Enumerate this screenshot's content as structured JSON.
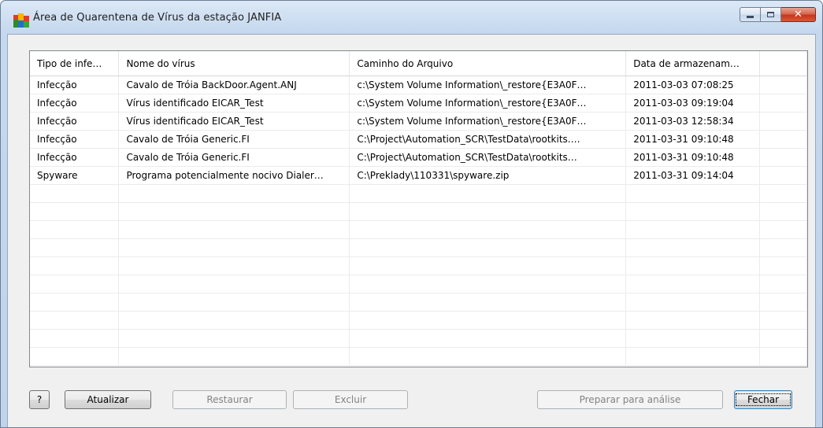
{
  "window": {
    "title": "Área de Quarentena de Vírus da estação JANFIA",
    "app_icon": "avg-logo-icon",
    "controls": {
      "minimize": "minimize-icon",
      "maximize": "maximize-icon",
      "close": "close-icon",
      "close_glyph": "✕"
    }
  },
  "table": {
    "columns": [
      "Tipo de infe…",
      "Nome do vírus",
      "Caminho do Arquivo",
      "Data de armazenam…",
      ""
    ],
    "rows": [
      [
        "Infecção",
        "Cavalo de Tróia BackDoor.Agent.ANJ",
        "c:\\System Volume Information\\_restore{E3A0F…",
        "2011-03-03 07:08:25",
        ""
      ],
      [
        "Infecção",
        "Vírus identificado EICAR_Test",
        "c:\\System Volume Information\\_restore{E3A0F…",
        "2011-03-03 09:19:04",
        ""
      ],
      [
        "Infecção",
        "Vírus identificado EICAR_Test",
        "c:\\System Volume Information\\_restore{E3A0F…",
        "2011-03-03 12:58:34",
        ""
      ],
      [
        "Infecção",
        "Cavalo de Tróia Generic.FI",
        "C:\\Project\\Automation_SCR\\TestData\\rootkits.…",
        "2011-03-31 09:10:48",
        ""
      ],
      [
        "Infecção",
        "Cavalo de Tróia Generic.FI",
        "C:\\Project\\Automation_SCR\\TestData\\rootkits…",
        "2011-03-31 09:10:48",
        ""
      ],
      [
        "Spyware",
        "Programa potencialmente nocivo Dialer…",
        "C:\\Preklady\\110331\\spyware.zip",
        "2011-03-31 09:14:04",
        ""
      ],
      [
        "",
        "",
        "",
        "",
        ""
      ],
      [
        "",
        "",
        "",
        "",
        ""
      ],
      [
        "",
        "",
        "",
        "",
        ""
      ],
      [
        "",
        "",
        "",
        "",
        ""
      ],
      [
        "",
        "",
        "",
        "",
        ""
      ],
      [
        "",
        "",
        "",
        "",
        ""
      ],
      [
        "",
        "",
        "",
        "",
        ""
      ],
      [
        "",
        "",
        "",
        "",
        ""
      ],
      [
        "",
        "",
        "",
        "",
        ""
      ],
      [
        "",
        "",
        "",
        "",
        ""
      ]
    ]
  },
  "buttons": {
    "help": "?",
    "refresh": "Atualizar",
    "restore": "Restaurar",
    "delete": "Excluir",
    "prepare": "Preparar para análise",
    "close": "Fechar"
  },
  "colors": {
    "title_bar": "#c6d8ee",
    "close_button": "#c4381c",
    "disabled_text": "#838383"
  }
}
